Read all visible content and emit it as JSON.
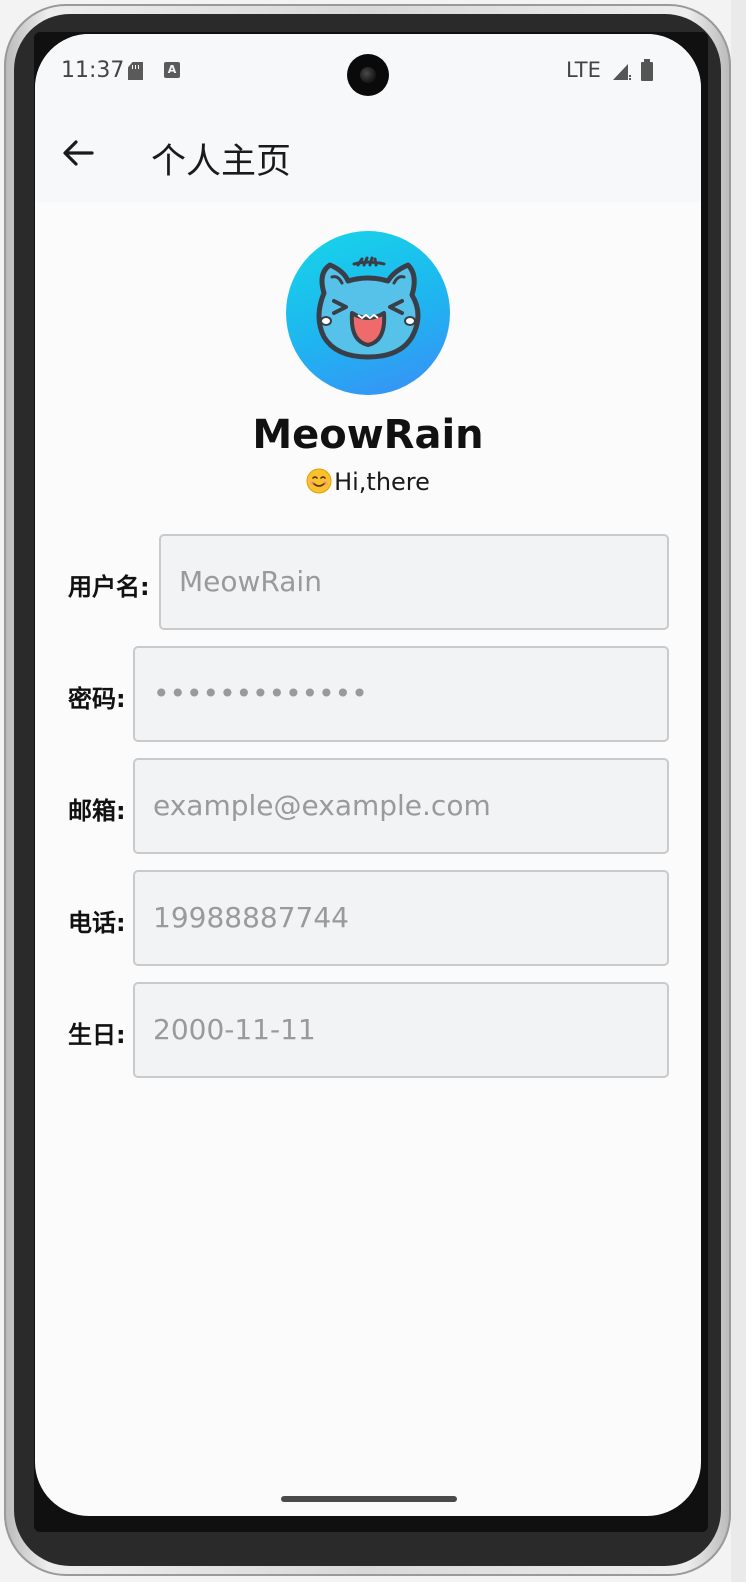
{
  "status_bar": {
    "time": "11:37",
    "network": "LTE",
    "icons": [
      "sd-card-icon",
      "a-notification-icon",
      "signal-icon",
      "battery-icon"
    ]
  },
  "app_bar": {
    "back_icon": "arrow-left-icon",
    "title": "个人主页"
  },
  "profile": {
    "avatar": "cat-avatar",
    "name": "MeowRain",
    "bio": "Hi,there",
    "bio_emoji": "smile-emoji"
  },
  "form": {
    "username": {
      "label": "用户名:",
      "placeholder": "MeowRain"
    },
    "password": {
      "label": "密码:",
      "placeholder": "•••••••••••••"
    },
    "email": {
      "label": "邮箱:",
      "placeholder": "example@example.com"
    },
    "phone": {
      "label": "电话:",
      "placeholder": "19988887744"
    },
    "birthday": {
      "label": "生日:",
      "placeholder": "2000-11-11"
    }
  },
  "colors": {
    "avatar_gradient_top": "#16d6e8",
    "avatar_gradient_bottom": "#3b8df7",
    "field_background": "#f2f3f5",
    "field_border": "#c9cacc",
    "placeholder_text": "#9a9a9a"
  }
}
